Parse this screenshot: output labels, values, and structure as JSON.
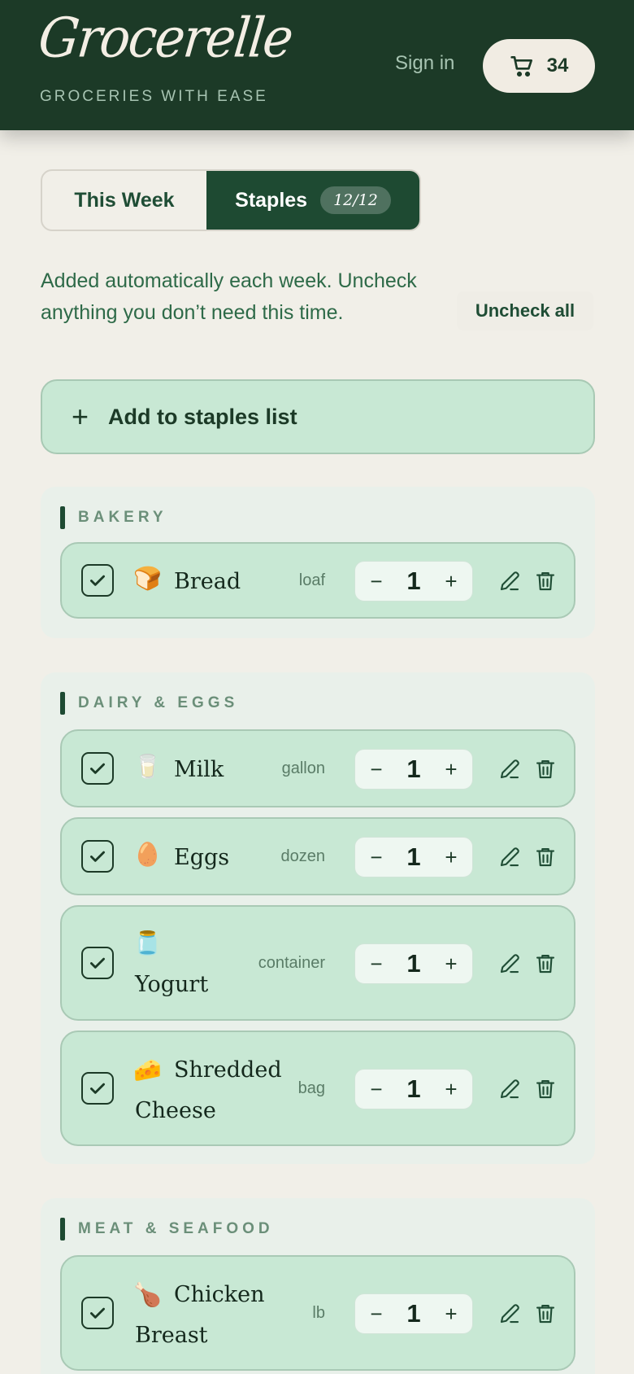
{
  "header": {
    "brand": "Grocerelle",
    "tagline": "GROCERIES WITH EASE",
    "sign_in": "Sign in",
    "cart_count": "34",
    "cart_icon": "cart-icon"
  },
  "tabs": {
    "this_week": "This Week",
    "staples": "Staples",
    "staples_badge": "12/12",
    "active": "staples"
  },
  "intro": {
    "note": "Added automatically each week. Uncheck anything you don’t need this time.",
    "uncheck_all": "Uncheck all"
  },
  "add_button": {
    "label": "Add to staples list",
    "icon": "plus-icon"
  },
  "sections": [
    {
      "title": "BAKERY",
      "items": [
        {
          "emoji": "🍞",
          "name": "Bread",
          "unit": "loaf",
          "qty": "1",
          "checked": true
        }
      ]
    },
    {
      "title": "DAIRY & EGGS",
      "items": [
        {
          "emoji": "🥛",
          "name": "Milk",
          "unit": "gallon",
          "qty": "1",
          "checked": true
        },
        {
          "emoji": "🥚",
          "name": "Eggs",
          "unit": "dozen",
          "qty": "1",
          "checked": true
        },
        {
          "emoji": "🫙",
          "name": "Yogurt",
          "unit": "container",
          "qty": "1",
          "checked": true
        },
        {
          "emoji": "🧀",
          "name": "Shredded Cheese",
          "unit": "bag",
          "qty": "1",
          "checked": true
        }
      ]
    },
    {
      "title": "MEAT & SEAFOOD",
      "items": [
        {
          "emoji": "🍗",
          "name": "Chicken Breast",
          "unit": "lb",
          "qty": "1",
          "checked": true
        }
      ]
    }
  ],
  "stepper": {
    "minus": "−",
    "plus": "+"
  },
  "colors": {
    "header_bg": "#1c3a27",
    "accent": "#1e4a32",
    "row_bg": "#c8e8d4",
    "page_bg": "#f1efe8"
  }
}
